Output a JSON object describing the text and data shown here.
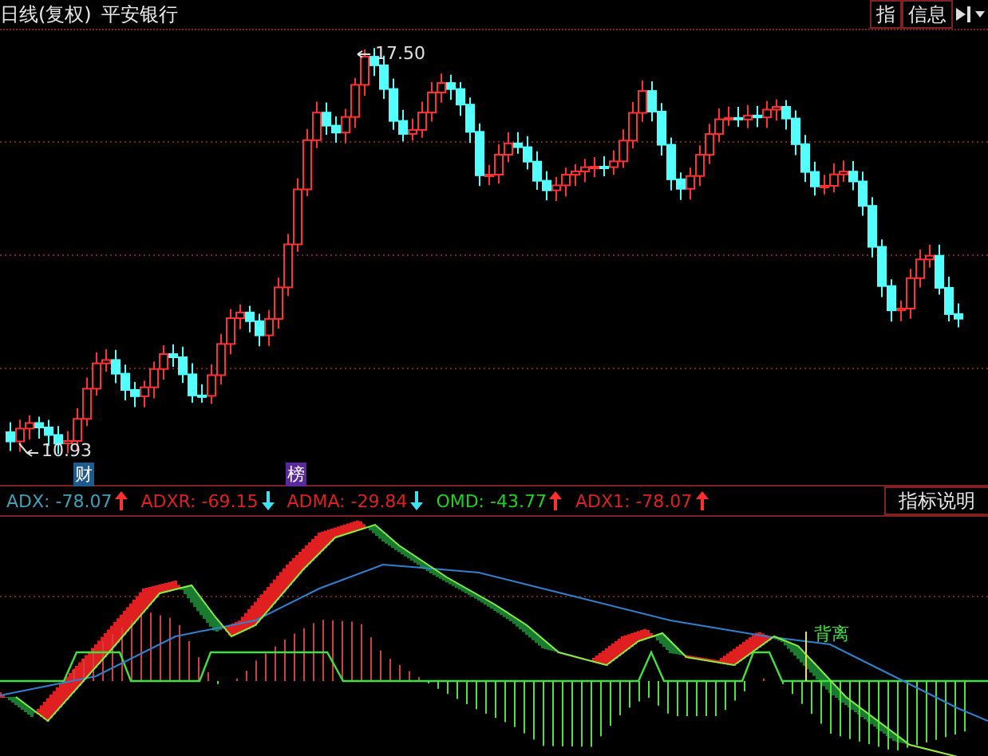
{
  "header": {
    "title": "日线(复权)",
    "stock_name": "平安银行",
    "buttons": [
      {
        "label": "指"
      },
      {
        "label": "信息"
      }
    ]
  },
  "price_chart": {
    "high_label": "17.50",
    "low_label": "10.93",
    "badges": [
      {
        "label": "财",
        "color": "#1e5a8c"
      },
      {
        "label": "榜",
        "color": "#5a2a9c"
      }
    ]
  },
  "indicator_legend": [
    {
      "name": "ADX:",
      "value": "-78.07",
      "color": "#3fa0b8",
      "rising": true
    },
    {
      "name": "ADXR:",
      "value": "-69.15",
      "color": "#e02020",
      "rising": false
    },
    {
      "name": "ADMA:",
      "value": "-29.84",
      "color": "#e02020",
      "rising": false
    },
    {
      "name": "OMD:",
      "value": "-43.77",
      "color": "#20d020",
      "rising": true
    },
    {
      "name": "ADX1:",
      "value": "-78.07",
      "color": "#e02020",
      "rising": true
    }
  ],
  "indicator_button": "指标说明",
  "indicator_chart": {
    "divergence_label": "背离"
  }
}
